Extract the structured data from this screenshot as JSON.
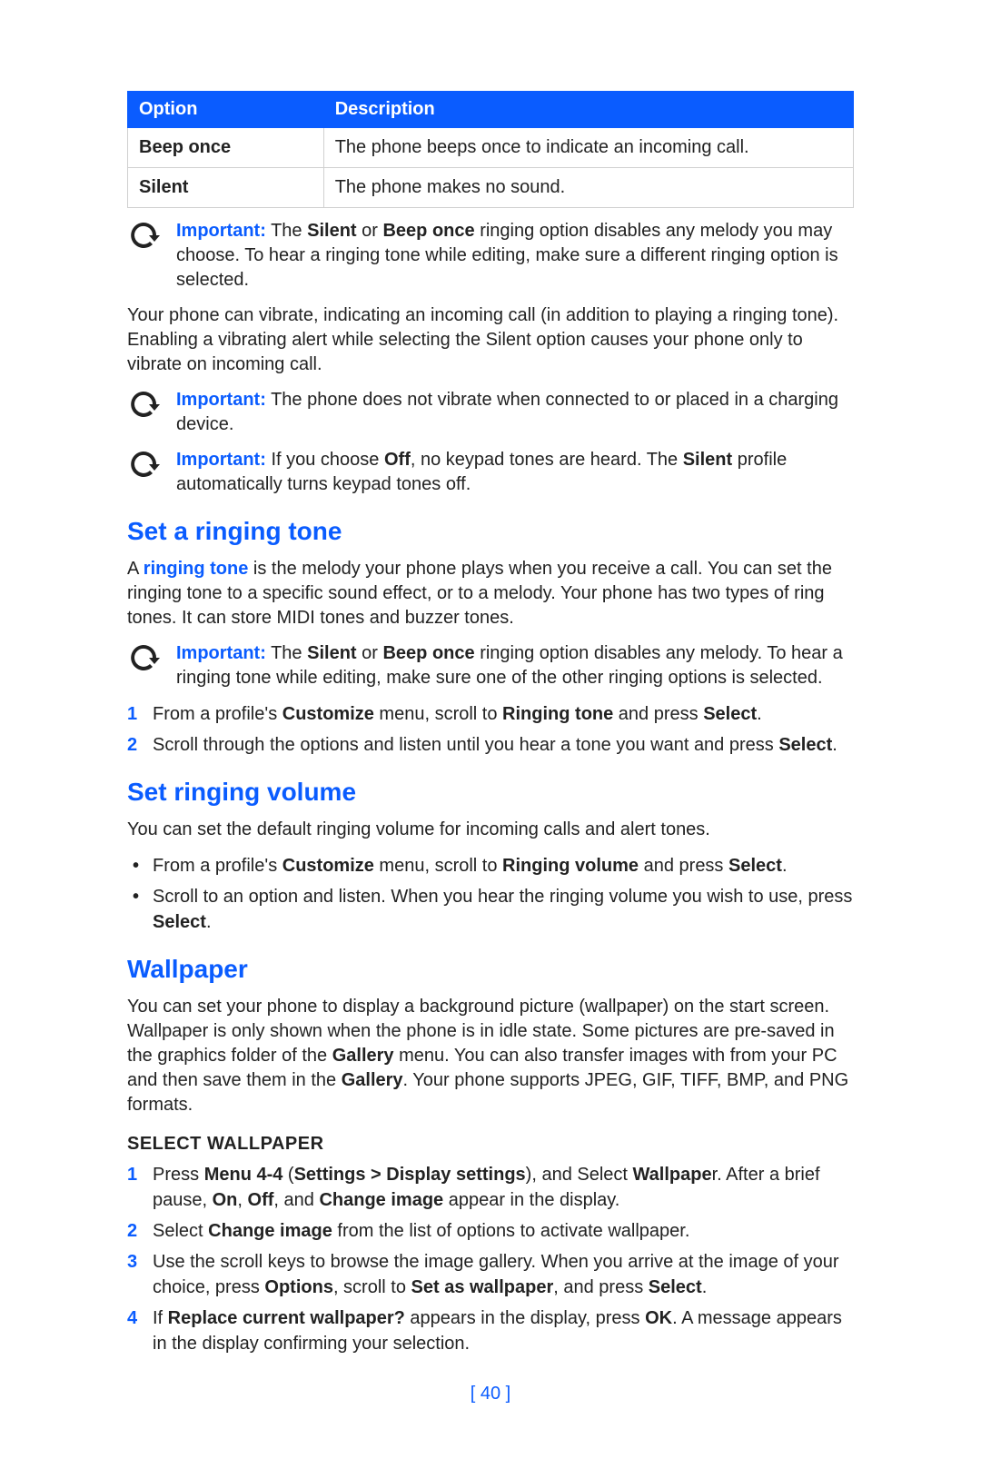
{
  "table": {
    "headers": {
      "option": "Option",
      "description": "Description"
    },
    "rows": [
      {
        "option": "Beep once",
        "description": "The phone beeps once to indicate an incoming call."
      },
      {
        "option": "Silent",
        "description": "The phone makes no sound."
      }
    ]
  },
  "labels": {
    "important": "Important:"
  },
  "notes": {
    "n1_before": "The ",
    "n1_b1": "Silent",
    "n1_mid1": " or ",
    "n1_b2": "Beep once",
    "n1_after": " ringing option disables any melody you may choose. To hear a ringing tone while editing, make sure a different ringing option is selected.",
    "n2": "The phone does not vibrate when connected to or placed in a charging device.",
    "n3_before": "If you choose ",
    "n3_b1": "Off",
    "n3_mid": ", no keypad tones are heard. The ",
    "n3_b2": "Silent",
    "n3_after": " profile automatically turns keypad tones off.",
    "n4_before": "The ",
    "n4_b1": "Silent",
    "n4_mid1": " or ",
    "n4_b2": "Beep once",
    "n4_after": " ringing option disables any melody. To hear a ringing tone while editing, make sure one of the other ringing options is selected."
  },
  "paragraphs": {
    "vibrate": "Your phone can vibrate, indicating an incoming call (in addition to playing a ringing tone). Enabling a vibrating alert while selecting the Silent option causes your phone only to vibrate on incoming call."
  },
  "sections": {
    "ringtone": {
      "heading": "Set a ringing tone",
      "intro_before": "A ",
      "intro_term": "ringing tone",
      "intro_after": " is the melody your phone plays when you receive a call. You can set the ringing tone to a specific sound effect, or to a melody. Your phone has two types of ring tones. It can store MIDI tones and buzzer tones.",
      "step1_a": "From a profile's ",
      "step1_b1": "Customize",
      "step1_b": " menu, scroll to ",
      "step1_b2": "Ringing tone",
      "step1_c": " and press ",
      "step1_b3": "Select",
      "step1_d": ".",
      "step2_a": "Scroll through the options and listen until you hear a tone you want and press ",
      "step2_b1": "Select",
      "step2_b": "."
    },
    "volume": {
      "heading": "Set ringing volume",
      "intro": "You can set the default ringing volume for incoming calls and alert tones.",
      "b1_a": "From a profile's ",
      "b1_b1": "Customize",
      "b1_b": " menu, scroll to ",
      "b1_b2": "Ringing volume",
      "b1_c": " and press ",
      "b1_b3": "Select",
      "b1_d": ".",
      "b2_a": "Scroll to an option and listen. When you hear the ringing volume you wish to use, press ",
      "b2_b1": "Select",
      "b2_b": "."
    },
    "wallpaper": {
      "heading": "Wallpaper",
      "intro_a": "You can set your phone to display a background picture (wallpaper) on the start screen. Wallpaper is only shown when the phone is in idle state. Some pictures are pre-saved in the graphics folder of the ",
      "intro_b1": "Gallery",
      "intro_b": " menu. You can also transfer images with from your PC and then save them in the ",
      "intro_b2": "Gallery",
      "intro_c": ". Your phone supports JPEG, GIF, TIFF, BMP, and PNG formats.",
      "sub": "SELECT WALLPAPER",
      "s1_a": "Press ",
      "s1_b1": "Menu 4-4",
      "s1_b": " (",
      "s1_b2": "Settings > Display settings",
      "s1_c": "), and Select ",
      "s1_b3": "Wallpape",
      "s1_d": "r. After a brief pause, ",
      "s1_b4": "On",
      "s1_e": ", ",
      "s1_b5": "Off",
      "s1_f": ", and ",
      "s1_b6": "Change image",
      "s1_g": " appear in the display.",
      "s2_a": "Select ",
      "s2_b1": "Change image",
      "s2_b": " from the list of options to activate wallpaper.",
      "s3_a": "Use the scroll keys to browse the image gallery. When you arrive at the image of your choice, press ",
      "s3_b1": "Options",
      "s3_b": ", scroll to ",
      "s3_b2": "Set as wallpaper",
      "s3_c": ", and press ",
      "s3_b3": "Select",
      "s3_d": ".",
      "s4_a": "If ",
      "s4_b1": "Replace current wallpaper?",
      "s4_b": " appears in the display, press ",
      "s4_b2": "OK",
      "s4_c": ". A message appears in the display confirming your selection."
    }
  },
  "page_number": "[ 40 ]"
}
